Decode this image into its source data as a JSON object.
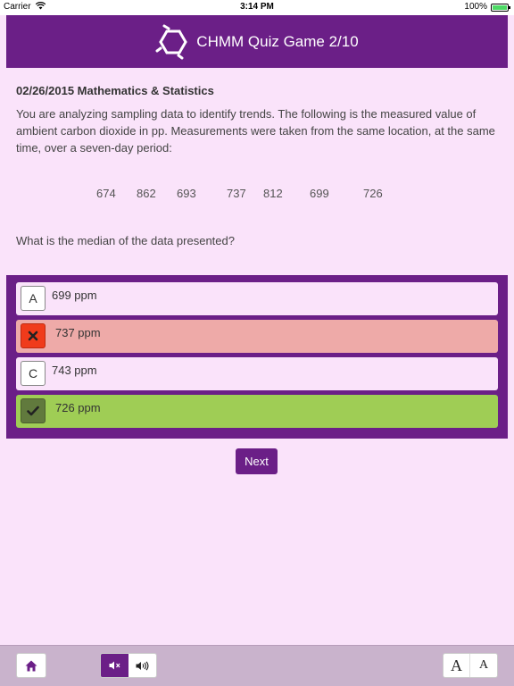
{
  "status_bar": {
    "carrier": "Carrier",
    "wifi_icon": "wifi-icon",
    "time": "3:14 PM",
    "battery_percent": "100%"
  },
  "header": {
    "logo_icon": "hexagon-logo-icon",
    "title": "CHMM Quiz Game 2/10",
    "color": "#6b1f87"
  },
  "question": {
    "heading": "02/26/2015 Mathematics & Statistics",
    "text": "You are analyzing sampling data to identify trends.  The following is the measured value of ambient carbon dioxide in pp.  Measurements were taken from the same location, at the same time, over a seven-day period:",
    "values": [
      "674",
      "862",
      "693",
      "737",
      "812",
      "699",
      "726"
    ],
    "prompt": "What is the median of the data presented?"
  },
  "answers": [
    {
      "badge": "A",
      "text": "699 ppm",
      "state": "neutral"
    },
    {
      "badge": "",
      "badge_icon": "x-mark-icon",
      "text": "737 ppm",
      "state": "wrong"
    },
    {
      "badge": "C",
      "text": "743 ppm",
      "state": "neutral"
    },
    {
      "badge": "",
      "badge_icon": "check-mark-icon",
      "text": "726 ppm",
      "state": "correct"
    }
  ],
  "next_label": "Next",
  "toolbar": {
    "home_icon": "home-icon",
    "mute_icon": "speaker-mute-icon",
    "sound_icon": "speaker-on-icon",
    "font_large_label": "A",
    "font_small_label": "A"
  },
  "colors": {
    "background": "#fae3fa",
    "accent": "#6b1f87",
    "wrong": "#eeaaa8",
    "correct": "#9fcd55"
  }
}
